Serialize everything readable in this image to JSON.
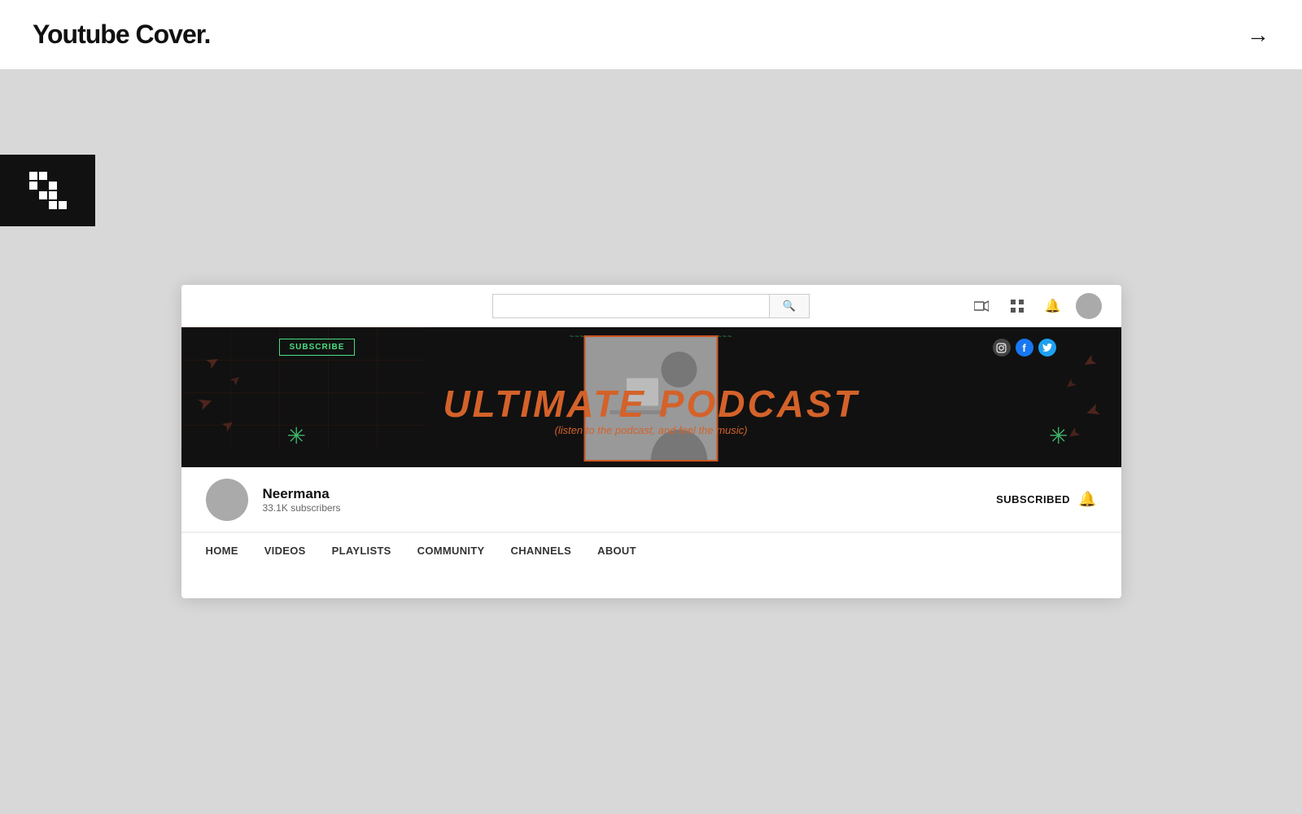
{
  "page": {
    "title": "Youtube Cover.",
    "arrow": "→"
  },
  "logo": {
    "aria": "logo-icon"
  },
  "youtube": {
    "search": {
      "placeholder": ""
    },
    "banner": {
      "subscribe_label": "SUBSCRIBE",
      "main_title": "ULTIMATE PODCAST",
      "subtitle": "(listen to the podcast, and feel the music)",
      "wavy": "~~~~~~~~~~~~~~~~~~~~~~~~~~~~~~~~",
      "social": [
        "ig",
        "fb",
        "tw"
      ]
    },
    "channel": {
      "name": "Neermana",
      "subscribers": "33.1K subscribers",
      "subscribed_label": "SUBSCRIBED"
    },
    "nav": {
      "tabs": [
        "HOME",
        "VIDEOS",
        "PLAYLISTS",
        "COMMUNITY",
        "CHANNELS",
        "ABOUT"
      ]
    }
  }
}
